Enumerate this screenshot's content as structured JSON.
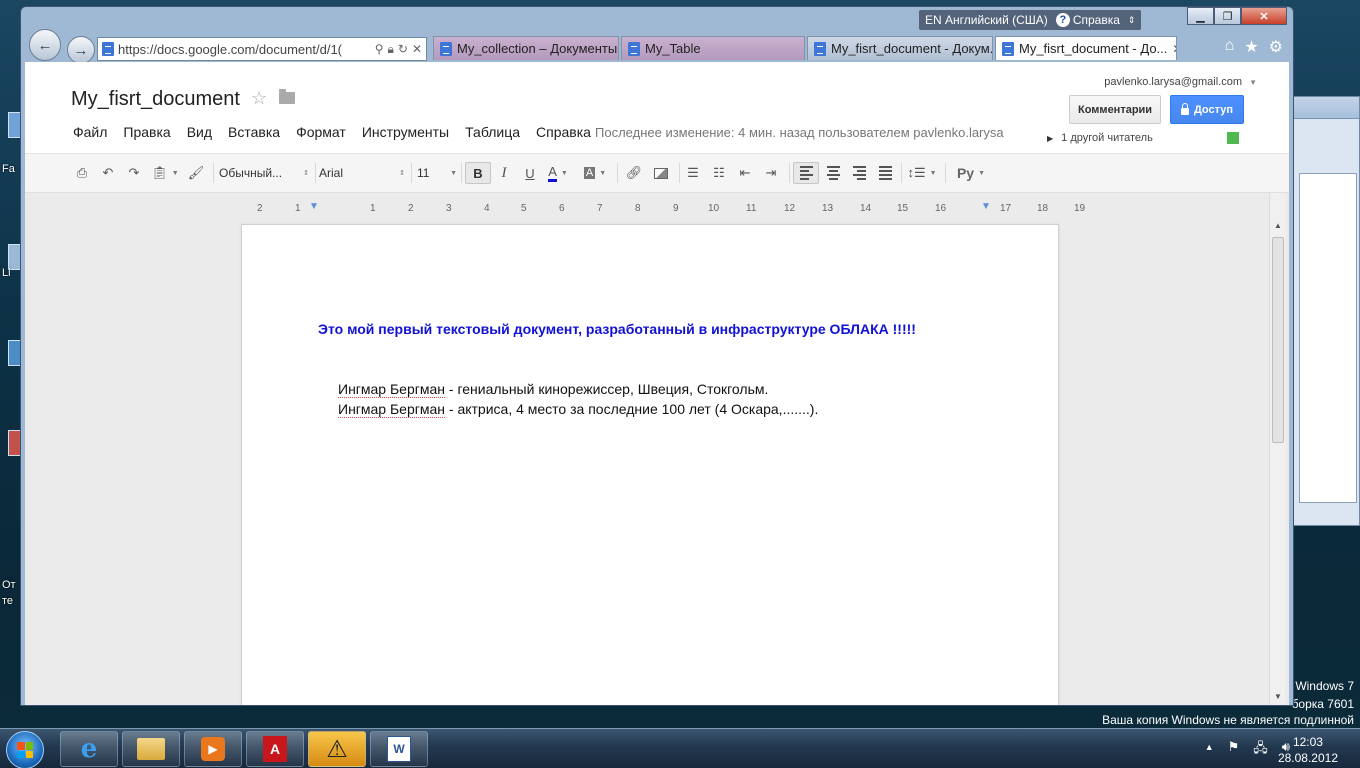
{
  "browser": {
    "address_url": "https://docs.google.com/document/d/1(",
    "tabs": [
      {
        "label": "My_collection – Документы..."
      },
      {
        "label": "My_Table"
      },
      {
        "label": "My_fisrt_document - Докум..."
      },
      {
        "label": "My_fisrt_document - До..."
      }
    ],
    "language_bar": {
      "lang": "EN Английский (США)",
      "help": "Справка"
    }
  },
  "docs": {
    "title": "My_fisrt_document",
    "menu": [
      "Файл",
      "Правка",
      "Вид",
      "Вставка",
      "Формат",
      "Инструменты",
      "Таблица",
      "Справка"
    ],
    "last_edit": "Последнее изменение: 4 мин. назад пользователем pavlenko.larysa",
    "account_email": "pavlenko.larysa@gmail.com",
    "comments_label": "Комментарии",
    "share_label": "Доступ",
    "viewers_text": "1 другой читатель",
    "toolbar": {
      "style": "Обычный...",
      "font": "Arial",
      "size": "11",
      "bold": "B",
      "italic": "I",
      "underline": "U",
      "text_color": "A",
      "highlight": "A",
      "input_tools": "Ру"
    },
    "ruler_numbers": [
      "2",
      "1",
      "1",
      "2",
      "3",
      "4",
      "5",
      "6",
      "7",
      "8",
      "9",
      "10",
      "11",
      "12",
      "13",
      "14",
      "15",
      "16",
      "17",
      "18",
      "19"
    ],
    "content": {
      "heading": "Это мой первый текстовый документ, разработанный в инфраструктуре ОБЛАКА !!!!!",
      "paragraphs": [
        {
          "name": "Ингмар Бергман",
          "rest": " - гениальный кинорежиссер, Швеция, Стокгольм."
        },
        {
          "name": "Ингмар Бергман",
          "rest": " - актриса, 4 место за последние 100 лет (4 Оскара,.......)."
        }
      ]
    }
  },
  "desktop": {
    "labels": [
      "Fa",
      "Li",
      "От",
      "те"
    ],
    "watermark": [
      "Windows 7",
      "борка 7601",
      "Ваша копия Windows не является подлинной"
    ]
  },
  "taskbar": {
    "time": "12:03",
    "date": "28.08.2012"
  }
}
